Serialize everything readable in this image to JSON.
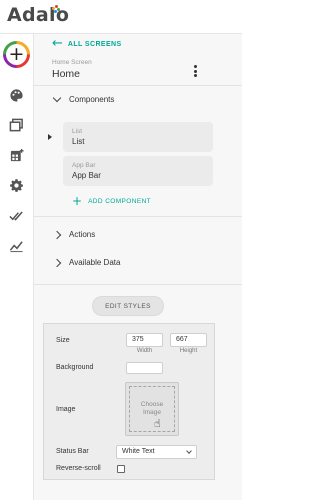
{
  "header": {
    "logo_text": "Adalo",
    "logo_dot_colors": [
      "#f9a825",
      "#e53935",
      "#43a047",
      "#1e88e5"
    ]
  },
  "rail": {
    "items": [
      {
        "icon": "add-circle-icon",
        "label": "+"
      },
      {
        "icon": "palette-icon"
      },
      {
        "icon": "screens-icon"
      },
      {
        "icon": "marketplace-icon"
      },
      {
        "icon": "gear-icon"
      },
      {
        "icon": "publish-check-icon"
      },
      {
        "icon": "analytics-icon"
      }
    ]
  },
  "panel": {
    "back_label": "ALL SCREENS",
    "screen_subtitle": "Home Screen",
    "screen_title": "Home",
    "components_label": "Components",
    "components": [
      {
        "type": "List",
        "name": "List",
        "expandable": true
      },
      {
        "type": "App Bar",
        "name": "App Bar",
        "expandable": false
      }
    ],
    "add_component_label": "ADD COMPONENT",
    "actions_label": "Actions",
    "available_data_label": "Available Data",
    "edit_styles_label": "EDIT STYLES",
    "styles": {
      "size_label": "Size",
      "width_value": "375",
      "width_caption": "Width",
      "height_value": "667",
      "height_caption": "Height",
      "background_label": "Background",
      "image_label": "Image",
      "choose_image_line1": "Choose",
      "choose_image_line2": "Image",
      "status_bar_label": "Status Bar",
      "status_bar_value": "White Text",
      "reverse_scroll_label": "Reverse-scroll",
      "reverse_scroll_checked": false
    }
  },
  "colors": {
    "accent": "#00a898",
    "panel_bg": "#f7f7f7",
    "card_bg": "#ebebeb"
  }
}
